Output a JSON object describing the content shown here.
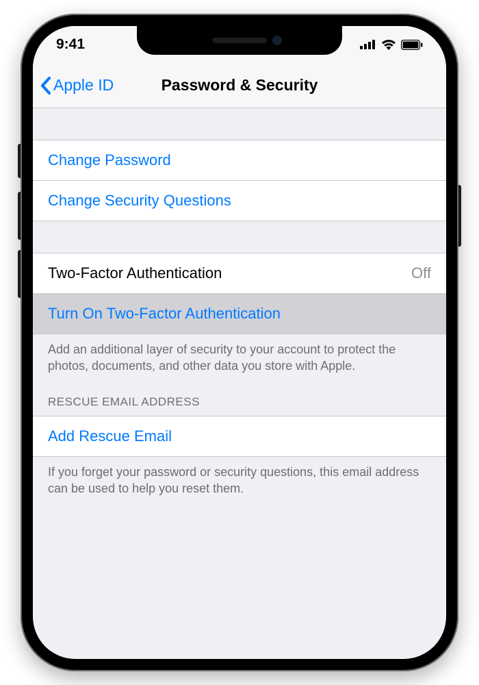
{
  "status_bar": {
    "time": "9:41"
  },
  "nav": {
    "back_label": "Apple ID",
    "title": "Password & Security"
  },
  "group1": {
    "change_password": "Change Password",
    "change_questions": "Change Security Questions"
  },
  "group2": {
    "tfa_label": "Two-Factor Authentication",
    "tfa_value": "Off",
    "turn_on_tfa": "Turn On Two-Factor Authentication",
    "tfa_footer": "Add an additional layer of security to your account to protect the photos, documents, and other data you store with Apple."
  },
  "group3": {
    "header": "RESCUE EMAIL ADDRESS",
    "add_rescue": "Add Rescue Email",
    "footer": "If you forget your password or security questions, this email address can be used to help you reset them."
  }
}
